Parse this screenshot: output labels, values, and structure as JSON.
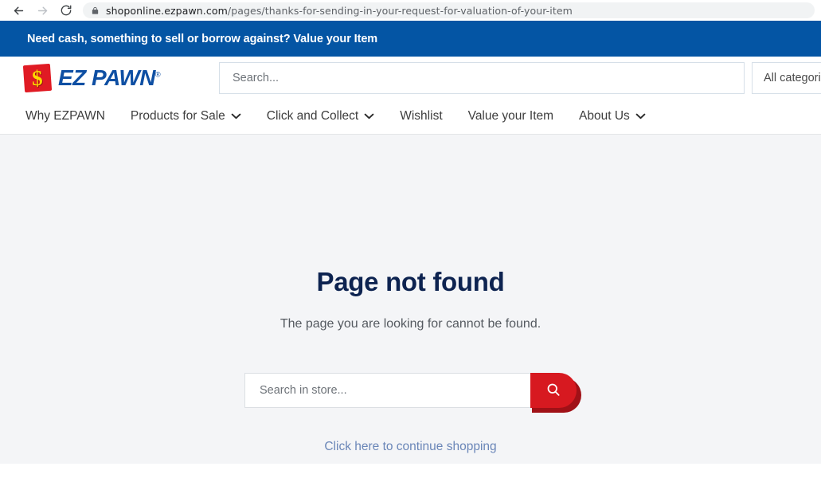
{
  "browser": {
    "back_icon": "arrow-left-icon",
    "forward_icon": "arrow-right-icon",
    "reload_icon": "reload-icon",
    "lock_icon": "lock-icon",
    "url_host": "shoponline.ezpawn.com",
    "url_path": "/pages/thanks-for-sending-in-your-request-for-valuation-of-your-item"
  },
  "announcement": {
    "text": "Need cash, something to sell or borrow against? Value your Item",
    "background": "#0455a4"
  },
  "header": {
    "logo": {
      "mark_symbol": "$",
      "wordmark": "EZ PAWN",
      "registered": "®",
      "mark_color": "#e01b24",
      "symbol_color": "#ffd900",
      "word_color": "#0e4fa3"
    },
    "search": {
      "placeholder": "Search...",
      "value": ""
    },
    "category_select": {
      "selected": "All categories"
    }
  },
  "nav": {
    "items": [
      {
        "label": "Why EZPAWN",
        "has_dropdown": false
      },
      {
        "label": "Products for Sale",
        "has_dropdown": true
      },
      {
        "label": "Click and Collect",
        "has_dropdown": true
      },
      {
        "label": "Wishlist",
        "has_dropdown": false
      },
      {
        "label": "Value your Item",
        "has_dropdown": false
      },
      {
        "label": "About Us",
        "has_dropdown": true
      }
    ]
  },
  "main": {
    "title": "Page not found",
    "title_color": "#0d2350",
    "subtitle": "The page you are looking for cannot be found.",
    "store_search": {
      "placeholder": "Search in store...",
      "value": "",
      "button_icon": "search-icon",
      "button_color": "#d71920"
    },
    "continue_link": "Click here to continue shopping",
    "continue_link_color": "#6a86b8",
    "background": "#f4f5f7"
  }
}
